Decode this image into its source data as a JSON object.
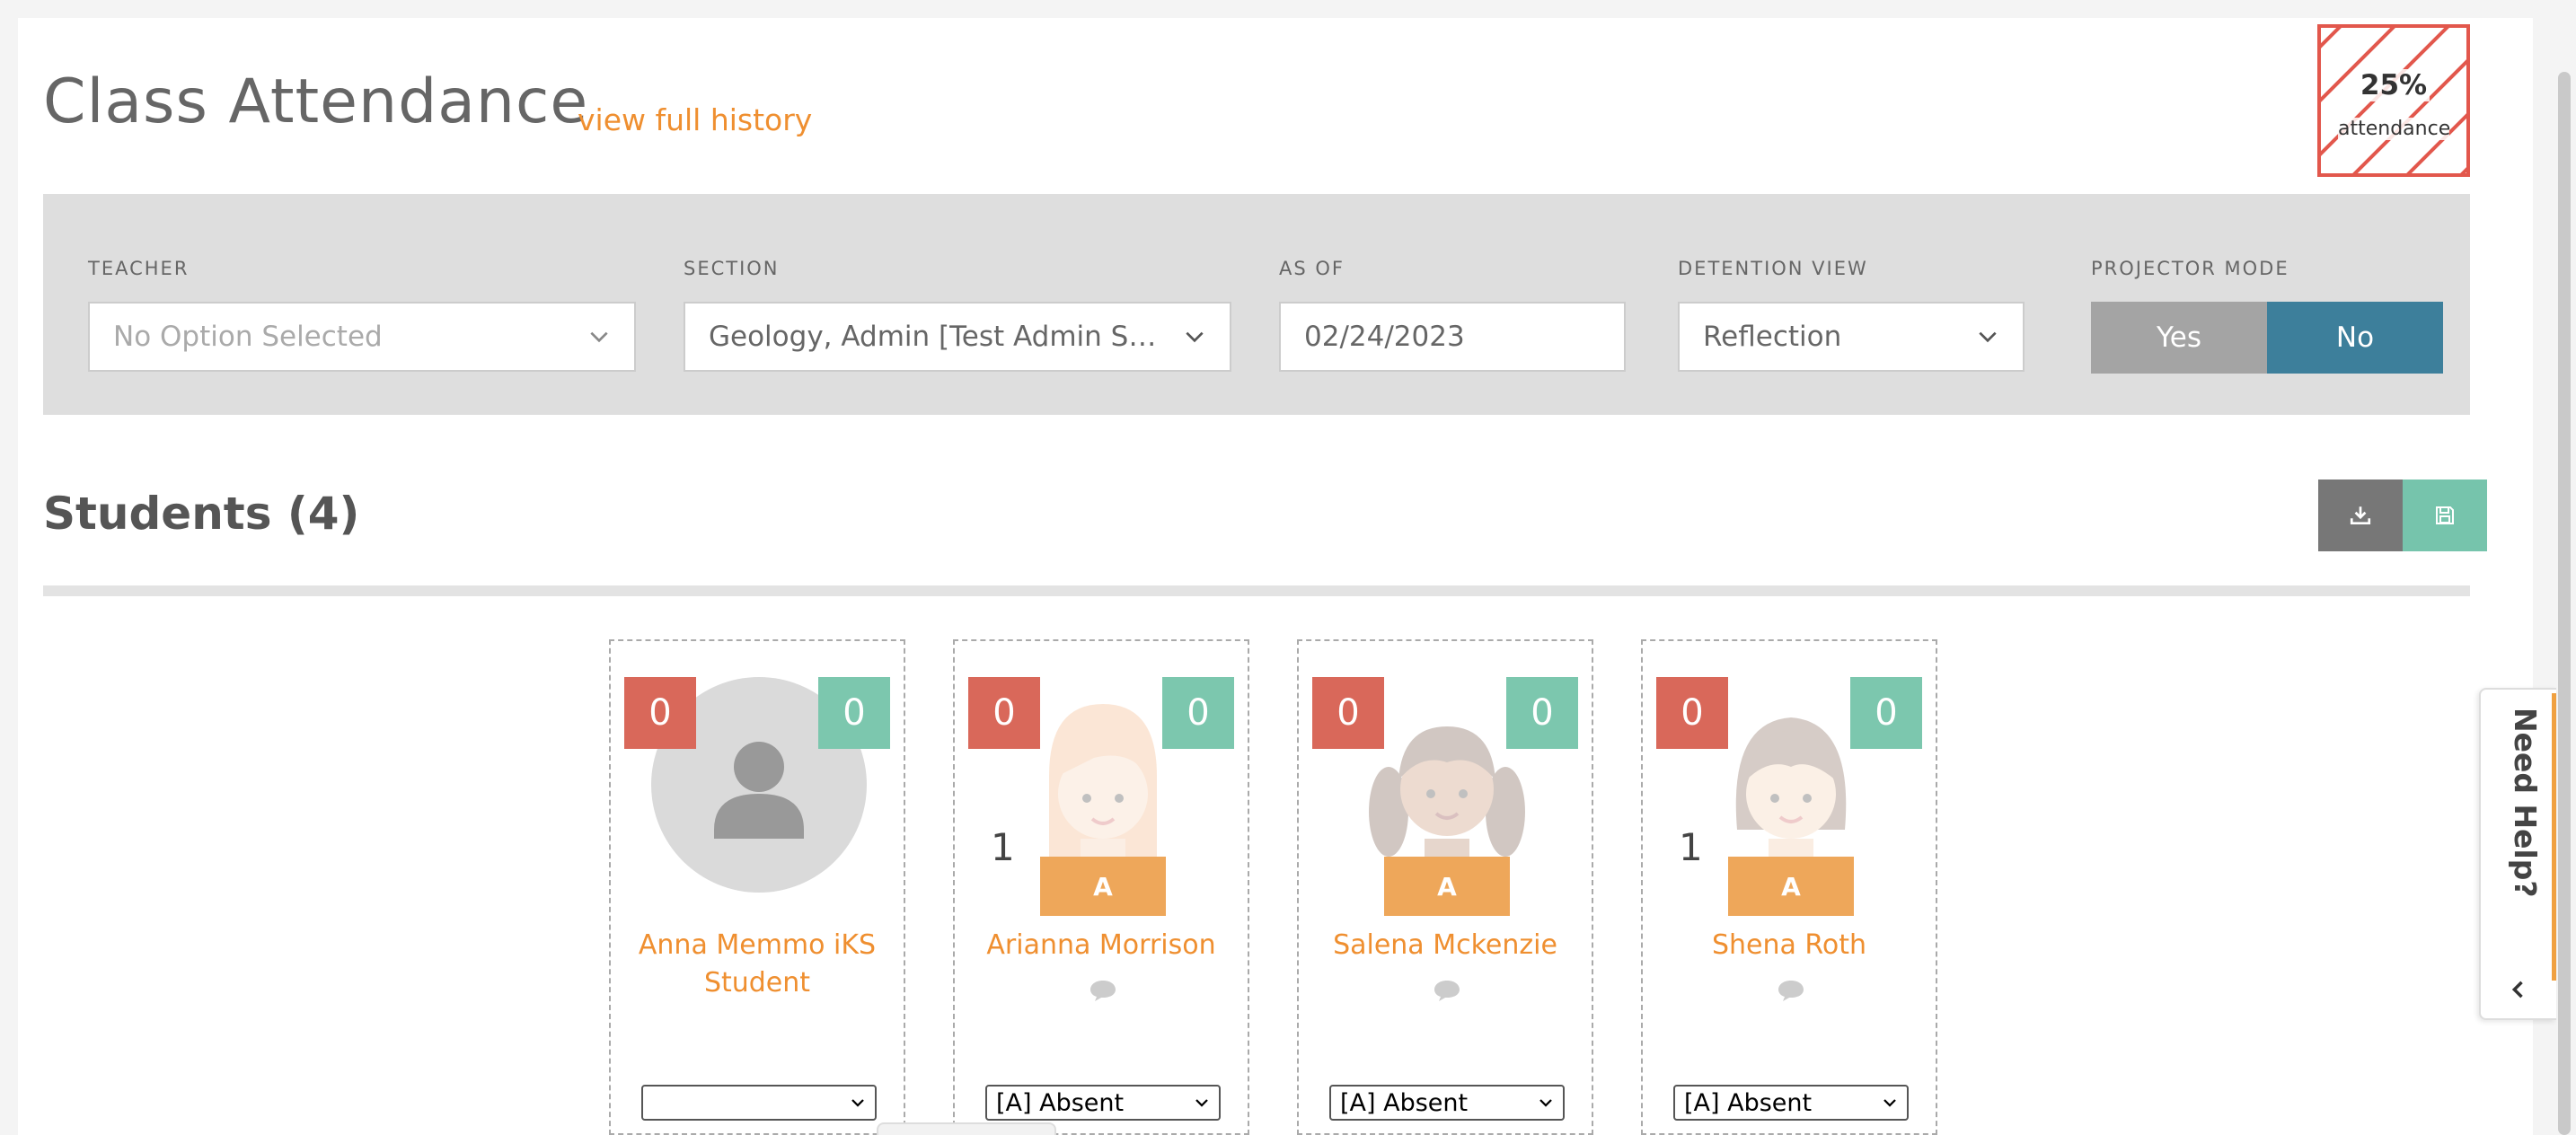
{
  "header": {
    "title": "Class Attendance",
    "history_link": "view full history",
    "attendance_pct": "25%",
    "attendance_label": "attendance"
  },
  "filters": {
    "teacher_label": "TEACHER",
    "teacher_value": "No Option Selected",
    "section_label": "SECTION",
    "section_value": "Geology, Admin [Test Admin Se…",
    "as_of_label": "AS OF",
    "as_of_value": "02/24/2023",
    "detention_label": "DETENTION VIEW",
    "detention_value": "Reflection",
    "projector_label": "PROJECTOR MODE",
    "projector_yes": "Yes",
    "projector_no": "No"
  },
  "students_heading": "Students (4)",
  "students": [
    {
      "name": "Anna Memmo iKS Student",
      "red_count": "0",
      "green_count": "0",
      "number": "",
      "status_badge": "",
      "status_select": "",
      "avatar": "generic-person-icon",
      "comment": false
    },
    {
      "name": "Arianna Morrison",
      "red_count": "0",
      "green_count": "0",
      "number": "1",
      "status_badge": "A",
      "status_select": "[A] Absent",
      "avatar": "girl-blonde",
      "comment": true
    },
    {
      "name": "Salena Mckenzie",
      "red_count": "0",
      "green_count": "0",
      "number": "",
      "status_badge": "A",
      "status_select": "[A] Absent",
      "avatar": "girl-pigtails",
      "comment": true
    },
    {
      "name": "Shena Roth",
      "red_count": "0",
      "green_count": "0",
      "number": "1",
      "status_badge": "A",
      "status_select": "[A] Absent",
      "avatar": "girl-bob",
      "comment": true
    }
  ],
  "help_tab": "Need Help?",
  "colors": {
    "accent_orange": "#ef8f30",
    "red": "#d9685a",
    "green": "#7cc7ae",
    "projector_no": "#3d7f9b",
    "absent_badge": "#eea75a"
  }
}
